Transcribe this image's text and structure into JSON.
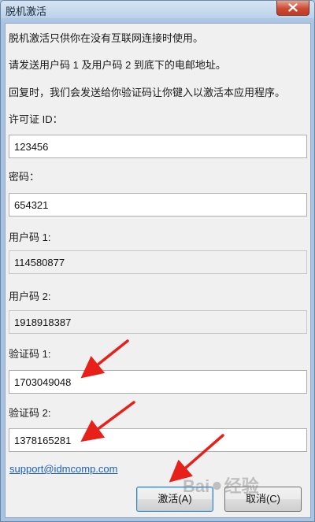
{
  "window": {
    "title": "脱机激活",
    "colors": {
      "frame": "#a8c4e2",
      "client": "#f0f0f0",
      "close": "#c94530",
      "arrow": "#e8201a",
      "link": "#1a5fc7"
    }
  },
  "intro": {
    "line1": "脱机激活只供你在没有互联网连接时使用。",
    "line2": "请发送用户码 1 及用户码 2 到底下的电邮地址。",
    "line3": "回复时，我们会发送给你验证码让你键入以激活本应用程序。"
  },
  "fields": {
    "license_id": {
      "label": "许可证 ID：",
      "value": "123456"
    },
    "password": {
      "label": "密码：",
      "value": "654321"
    },
    "user_code_1": {
      "label": "用户码 1:",
      "value": "114580877"
    },
    "user_code_2": {
      "label": "用户码 2:",
      "value": "1918918387"
    },
    "verify_code_1": {
      "label": "验证码 1:",
      "value": "1703049048"
    },
    "verify_code_2": {
      "label": "验证码 2:",
      "value": "1378165281"
    }
  },
  "support_email": "support@idmcomp.com",
  "buttons": {
    "activate": "激活(A)",
    "cancel": "取消(C)"
  },
  "icons": {
    "close": "close-icon"
  }
}
